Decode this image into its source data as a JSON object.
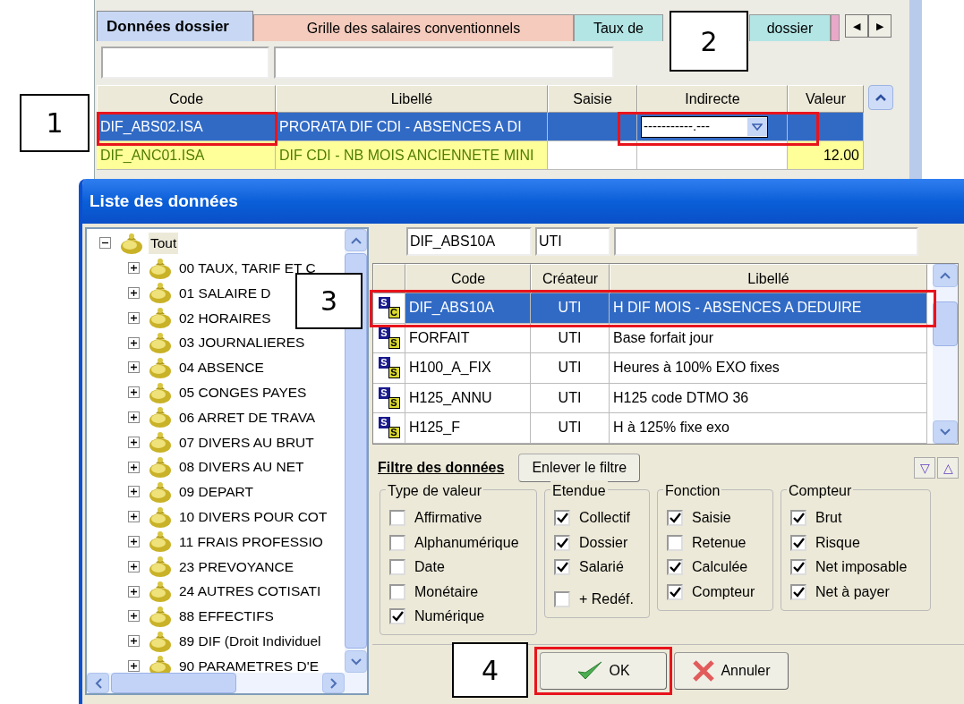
{
  "main_window": {
    "tabs": [
      {
        "label_parts": [
          "Données dossier"
        ],
        "selected": true,
        "color": "#c8d8f4"
      },
      {
        "label_parts": [
          "Grille des salaires conventionnels"
        ],
        "selected": false,
        "color": "#f4cbbd"
      },
      {
        "label_parts": [
          "Taux de",
          "dossier"
        ],
        "selected": false,
        "color": "#b3e5e5"
      }
    ],
    "tab_scroll": [
      "◀",
      "▶"
    ],
    "grid": {
      "columns": [
        "Code",
        "Libellé",
        "Saisie",
        "Indirecte",
        "Valeur"
      ],
      "rows": [
        {
          "code": "DIF_ABS02.ISA",
          "libelle": "PRORATA DIF CDI - ABSENCES A DI",
          "indirecte": "-----------.---",
          "selected": true,
          "highlight": false
        },
        {
          "code": "DIF_ANC01.ISA",
          "libelle": "DIF CDI - NB MOIS ANCIENNETE MINI",
          "valeur": "12.00",
          "selected": false,
          "highlight": true
        }
      ]
    }
  },
  "dialog": {
    "title": "Liste des données",
    "tree": [
      {
        "label": "Tout",
        "expanded": true,
        "selected": true,
        "children": [
          {
            "label": "00 TAUX, TARIF ET C",
            "expanded": false,
            "selected": false
          },
          {
            "label": "01 SALAIRE D",
            "expanded": false,
            "selected": false
          },
          {
            "label": "02 HORAIRES",
            "expanded": false,
            "selected": false
          },
          {
            "label": "03 JOURNALIERES",
            "expanded": false,
            "selected": false
          },
          {
            "label": "04 ABSENCE",
            "expanded": false,
            "selected": false
          },
          {
            "label": "05 CONGES PAYES",
            "expanded": false,
            "selected": false
          },
          {
            "label": "06 ARRET DE TRAVA",
            "expanded": false,
            "selected": false
          },
          {
            "label": "07 DIVERS AU BRUT",
            "expanded": false,
            "selected": false
          },
          {
            "label": "08 DIVERS AU NET",
            "expanded": false,
            "selected": false
          },
          {
            "label": "09 DEPART",
            "expanded": false,
            "selected": false
          },
          {
            "label": "10 DIVERS POUR COT",
            "expanded": false,
            "selected": false
          },
          {
            "label": "11 FRAIS PROFESSIO",
            "expanded": false,
            "selected": false
          },
          {
            "label": "23 PREVOYANCE",
            "expanded": false,
            "selected": false
          },
          {
            "label": "24 AUTRES COTISATI",
            "expanded": false,
            "selected": false
          },
          {
            "label": "88 EFFECTIFS",
            "expanded": false,
            "selected": false
          },
          {
            "label": "89 DIF (Droit Individuel",
            "expanded": false,
            "selected": false
          },
          {
            "label": "90 PARAMETRES D'E",
            "expanded": false,
            "selected": false
          }
        ]
      }
    ],
    "filters": {
      "code": "DIF_ABS10A",
      "createur": "UTI"
    },
    "grid": {
      "columns": [
        "Code",
        "Créateur",
        "Libellé"
      ],
      "rows": [
        {
          "icon": [
            "S",
            "C"
          ],
          "code": "DIF_ABS10A",
          "createur": "UTI",
          "libelle": "H DIF MOIS - ABSENCES A DEDUIRE",
          "selected": true
        },
        {
          "icon": [
            "S",
            "S"
          ],
          "code": "FORFAIT",
          "createur": "UTI",
          "libelle": "Base forfait jour",
          "selected": false
        },
        {
          "icon": [
            "S",
            "S"
          ],
          "code": "H100_A_FIX",
          "createur": "UTI",
          "libelle": "Heures à 100% EXO fixes",
          "selected": false
        },
        {
          "icon": [
            "S",
            "S"
          ],
          "code": "H125_ANNU",
          "createur": "UTI",
          "libelle": "H125 code DTMO 36",
          "selected": false
        },
        {
          "icon": [
            "S",
            "S"
          ],
          "code": "H125_F",
          "createur": "UTI",
          "libelle": "H à 125% fixe exo",
          "selected": false
        }
      ]
    },
    "filter_section": {
      "title": "Filtre des données",
      "clear_button": "Enlever le filtre",
      "collapse_arrows": [
        "▽",
        "△"
      ],
      "groups": [
        {
          "title": "Type de valeur",
          "items": [
            {
              "label": "Affirmative",
              "checked": false
            },
            {
              "label": "Alphanumérique",
              "checked": false
            },
            {
              "label": "Date",
              "checked": false
            },
            {
              "label": "Monétaire",
              "checked": false
            },
            {
              "label": "Numérique",
              "checked": true
            }
          ]
        },
        {
          "title": "Etendue",
          "items": [
            {
              "label": "Collectif",
              "checked": true
            },
            {
              "label": "Dossier",
              "checked": true
            },
            {
              "label": "Salarié",
              "checked": true
            }
          ],
          "extra_items": [
            {
              "label": "+ Redéf.",
              "checked": false
            }
          ]
        },
        {
          "title": "Fonction",
          "items": [
            {
              "label": "Saisie",
              "checked": true
            },
            {
              "label": "Retenue",
              "checked": false
            },
            {
              "label": "Calculée",
              "checked": true
            },
            {
              "label": "Compteur",
              "checked": true
            }
          ]
        },
        {
          "title": "Compteur",
          "items": [
            {
              "label": "Brut",
              "checked": true
            },
            {
              "label": "Risque",
              "checked": true
            },
            {
              "label": "Net imposable",
              "checked": true
            },
            {
              "label": "Net à payer",
              "checked": true
            }
          ]
        }
      ]
    },
    "buttons": [
      {
        "label": "OK",
        "kind": "ok"
      },
      {
        "label": "Annuler",
        "kind": "cancel"
      }
    ]
  },
  "callouts": [
    {
      "number": "1"
    },
    {
      "number": "2"
    },
    {
      "number": "3"
    },
    {
      "number": "4"
    }
  ]
}
